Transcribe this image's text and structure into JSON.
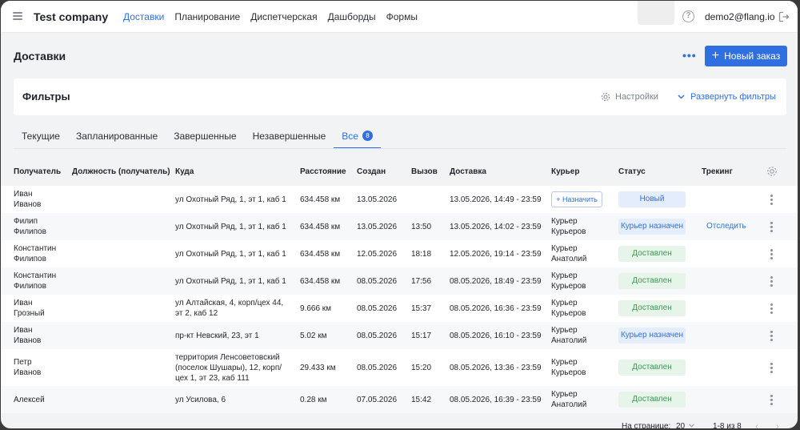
{
  "app": {
    "company": "Test company",
    "nav": [
      "Доставки",
      "Планирование",
      "Диспетчерская",
      "Дашборды",
      "Формы"
    ],
    "active_nav": "Доставки",
    "user_email": "demo2@flang.io",
    "help_glyph": "?"
  },
  "page": {
    "title": "Доставки",
    "more_label": "•••",
    "new_order_label": "Новый заказ"
  },
  "filters": {
    "title": "Фильтры",
    "settings_label": "Настройки",
    "expand_label": "Развернуть фильтры"
  },
  "tabs": [
    {
      "label": "Текущие"
    },
    {
      "label": "Запланированные"
    },
    {
      "label": "Завершенные"
    },
    {
      "label": "Незавершенные"
    },
    {
      "label": "Все",
      "count": "8",
      "active": true
    }
  ],
  "table": {
    "headers": [
      "Получатель",
      "Должность (получатель)",
      "Куда",
      "Расстояние",
      "Создан",
      "Вызов",
      "Доставка",
      "Курьер",
      "Статус",
      "Трекинг"
    ],
    "assign_label": "+ Назначить",
    "track_label": "Отследить",
    "rows": [
      {
        "recipient": [
          "Иван",
          "Иванов"
        ],
        "address": [
          "ул Охотный Ряд, 1, эт 1, каб 1"
        ],
        "distance": "634.458 км",
        "created": "13.05.2026",
        "call": "",
        "delivery": "13.05.2026, 14:49 - 23:59",
        "courier": [],
        "assign": true,
        "status": "Новый",
        "status_kind": "new",
        "track": false
      },
      {
        "recipient": [
          "Филип",
          "Филипов"
        ],
        "address": [
          "ул Охотный Ряд, 1, эт 1, каб 1"
        ],
        "distance": "634.458 км",
        "created": "13.05.2026",
        "call": "13:50",
        "delivery": "13.05.2026, 14:02 - 23:59",
        "courier": [
          "Курьер",
          "Курьеров"
        ],
        "assign": false,
        "status": "Курьер назначен",
        "status_kind": "assigned",
        "track": true
      },
      {
        "recipient": [
          "Константин",
          "Филипов"
        ],
        "address": [
          "ул Охотный Ряд, 1, эт 1, каб 1"
        ],
        "distance": "634.458 км",
        "created": "12.05.2026",
        "call": "18:18",
        "delivery": "12.05.2026, 19:14 - 23:59",
        "courier": [
          "Курьер",
          "Анатолий"
        ],
        "assign": false,
        "status": "Доставлен",
        "status_kind": "done",
        "track": false
      },
      {
        "recipient": [
          "Константин",
          "Филипов"
        ],
        "address": [
          "ул Охотный Ряд, 1, эт 1, каб 1"
        ],
        "distance": "634.458 км",
        "created": "08.05.2026",
        "call": "17:56",
        "delivery": "08.05.2026, 18:49 - 23:59",
        "courier": [
          "Курьер",
          "Курьеров"
        ],
        "assign": false,
        "status": "Доставлен",
        "status_kind": "done",
        "track": false
      },
      {
        "recipient": [
          "Иван",
          "Грозный"
        ],
        "address": [
          "ул Алтайская, 4, корп/цех 44,",
          "эт 2, каб 12"
        ],
        "distance": "9.666 км",
        "created": "08.05.2026",
        "call": "15:37",
        "delivery": "08.05.2026, 16:36 - 23:59",
        "courier": [
          "Курьер",
          "Курьеров"
        ],
        "assign": false,
        "status": "Доставлен",
        "status_kind": "done",
        "track": false
      },
      {
        "recipient": [
          "Иван",
          "Иванов"
        ],
        "address": [
          "пр-кт Невский, 23, эт 1"
        ],
        "distance": "5.02 км",
        "created": "08.05.2026",
        "call": "15:17",
        "delivery": "08.05.2026, 16:10 - 23:59",
        "courier": [
          "Курьер",
          "Анатолий"
        ],
        "assign": false,
        "status": "Курьер назначен",
        "status_kind": "assigned",
        "track": false
      },
      {
        "recipient": [
          "Петр",
          "Иванов"
        ],
        "address": [
          "территория Ленсоветовский",
          "(поселок Шушары), 12, корп/",
          "цех 1, эт 23, каб 111"
        ],
        "distance": "29.433 км",
        "created": "08.05.2026",
        "call": "15:20",
        "delivery": "08.05.2026, 13:36 - 23:59",
        "courier": [
          "Курьер",
          "Курьеров"
        ],
        "assign": false,
        "status": "Доставлен",
        "status_kind": "done",
        "track": false
      },
      {
        "recipient": [
          "Алексей"
        ],
        "address": [
          "ул Усилова, 6"
        ],
        "distance": "0.28 км",
        "created": "07.05.2026",
        "call": "15:42",
        "delivery": "08.05.2026, 16:39 - 23:59",
        "courier": [
          "Курьер",
          "Анатолий"
        ],
        "assign": false,
        "status": "Доставлен",
        "status_kind": "done",
        "track": false
      }
    ]
  },
  "pager": {
    "per_page_label": "На странице:",
    "per_page_value": "20",
    "range": "1-8 из 8",
    "prev_glyph": "‹",
    "next_glyph": "›"
  },
  "colors": {
    "accent": "#2f6fe0",
    "done_bg": "#e6f4ea",
    "done_text": "#3a9a53",
    "info_bg": "#e3edfb"
  }
}
